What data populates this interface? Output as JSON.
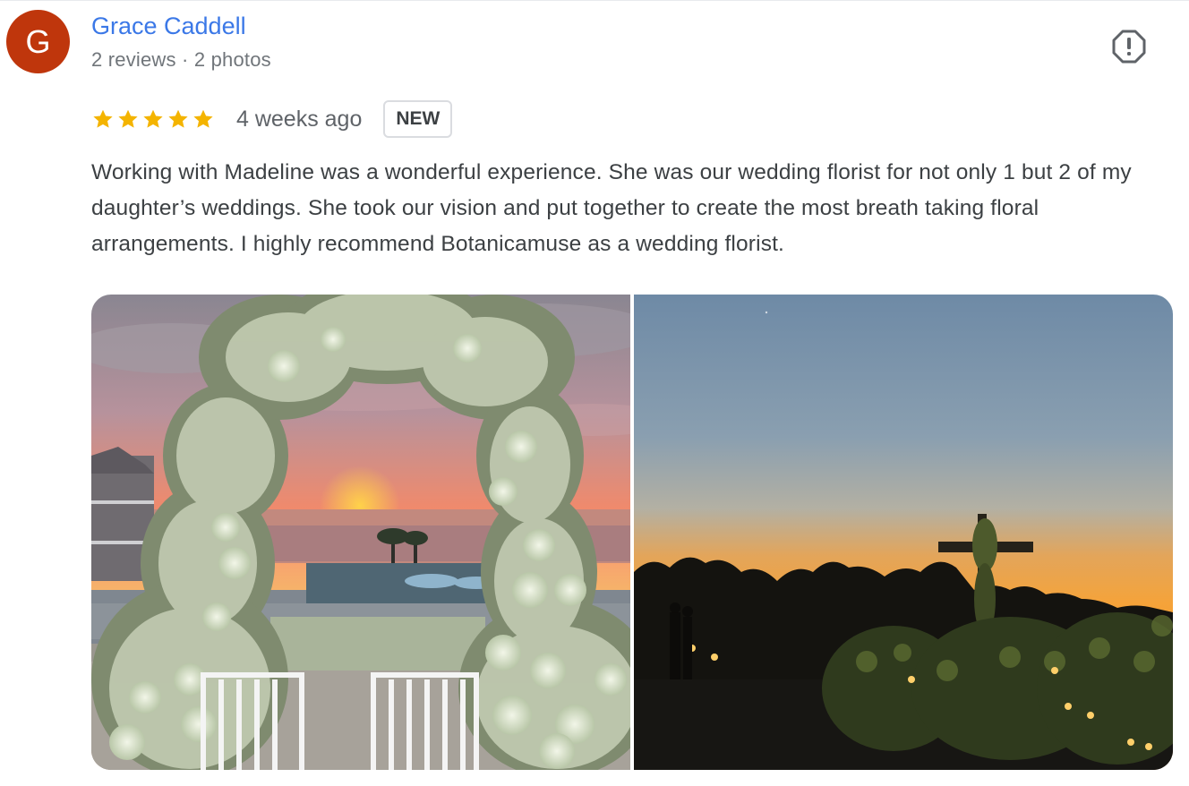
{
  "review": {
    "avatar_letter": "G",
    "reviewer_name": "Grace Caddell",
    "reviewer_meta": "2 reviews · 2 photos",
    "rating": 5,
    "rating_max": 5,
    "date": "4 weeks ago",
    "badge": "NEW",
    "text": "Working with Madeline was a wonderful experience. She was our wedding florist for not only 1 but 2 of my daughter’s weddings. She took our vision and put together to create the most breath taking floral arrangements. I highly recommend Botanicamuse as a wedding florist.",
    "report_icon": "report-icon"
  },
  "colors": {
    "avatar_bg": "#bf360c",
    "name_link": "#3b78e7",
    "star": "#f4b400",
    "text": "#3c4043",
    "meta": "#70757a"
  },
  "photos": [
    {
      "icon": "photo-floral-arch-sunset"
    },
    {
      "icon": "photo-floral-cross-dusk"
    }
  ]
}
